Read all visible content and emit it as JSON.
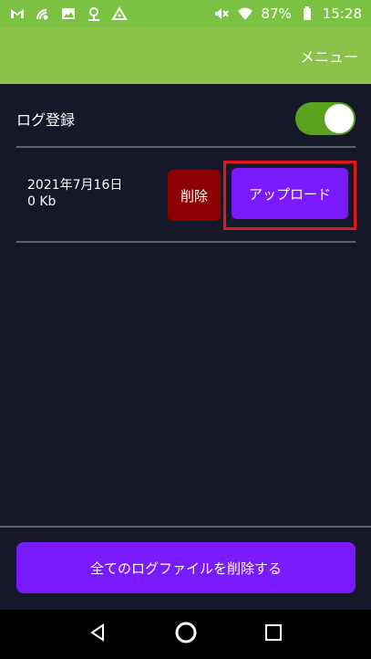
{
  "status_bar": {
    "battery": "87%",
    "time": "15:28",
    "icons": [
      "gmail-icon",
      "signal-icon",
      "image-icon",
      "location-icon",
      "triangle-icon",
      "mute-icon",
      "wifi-icon",
      "battery-icon"
    ]
  },
  "app_bar": {
    "menu_label": "メニュー"
  },
  "settings": {
    "log_label": "ログ登録",
    "log_enabled": true
  },
  "file": {
    "date": "2021年7月16日",
    "size": "0 Kb",
    "delete_label": "削除",
    "upload_label": "アップロード"
  },
  "footer": {
    "delete_all_label": "全てのログファイルを削除する"
  },
  "colors": {
    "appbar": "#8bc34a",
    "background": "#141828",
    "accent": "#7a1aff",
    "danger": "#8b0000",
    "highlight": "#e2181e"
  }
}
